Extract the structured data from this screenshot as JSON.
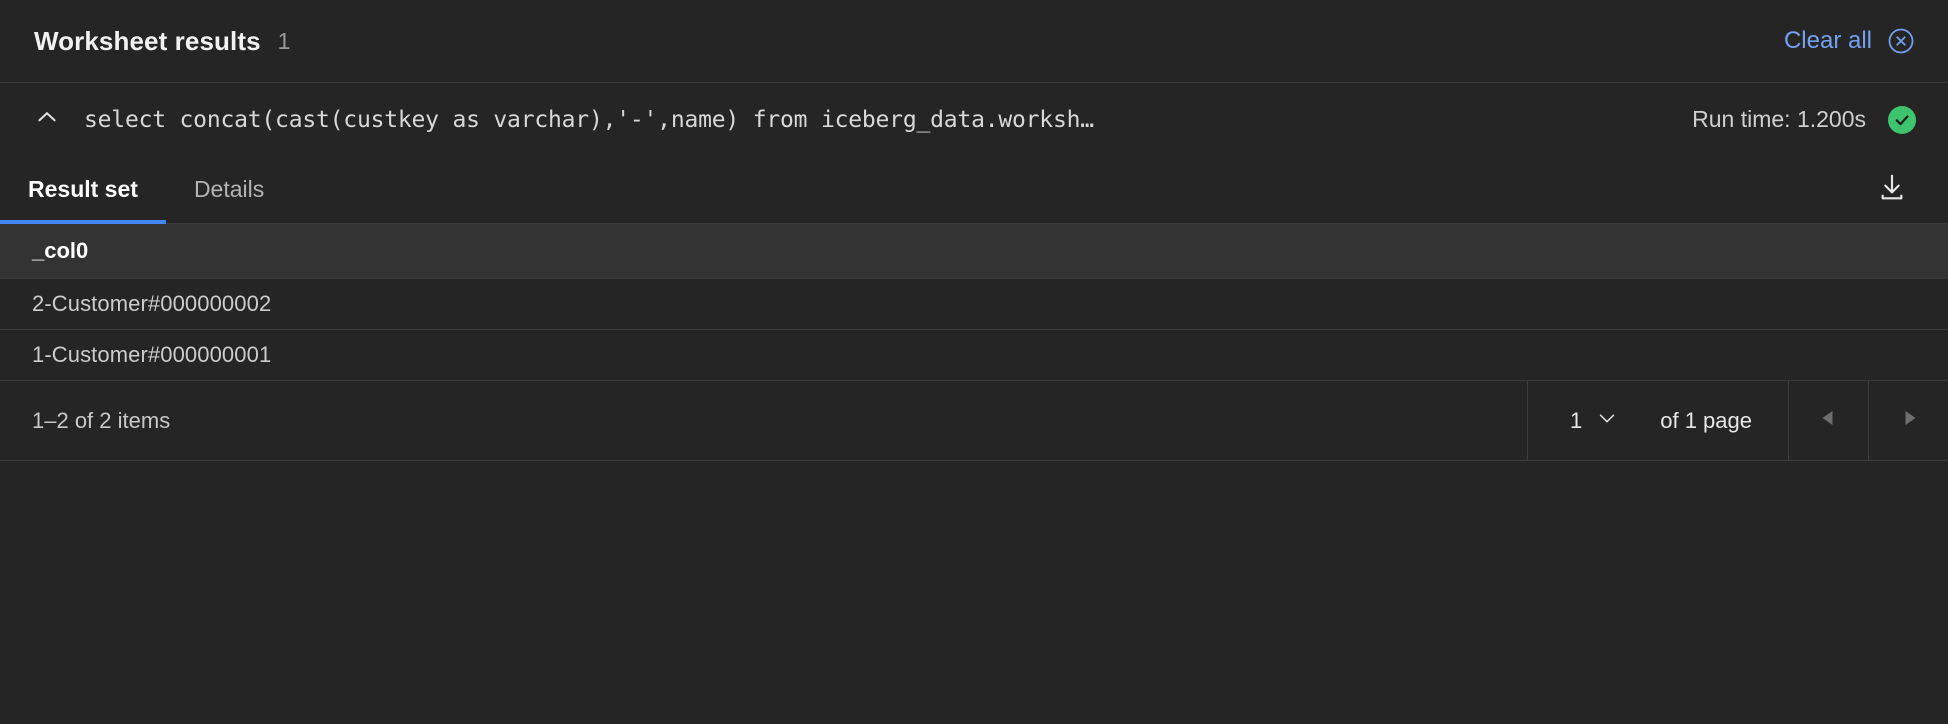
{
  "header": {
    "title": "Worksheet results",
    "count": "1",
    "clear_all_label": "Clear all",
    "close_icon": "close-circle-icon"
  },
  "query": {
    "collapse_icon": "chevron-up-icon",
    "sql": "select concat(cast(custkey as varchar),'-',name) from iceberg_data.worksh…",
    "runtime_label": "Run time: 1.200s",
    "status_icon": "check-circle-icon"
  },
  "tabs": [
    {
      "label": "Result set",
      "active": true
    },
    {
      "label": "Details",
      "active": false
    }
  ],
  "toolbar": {
    "download_icon": "download-icon"
  },
  "table": {
    "columns": [
      "_col0"
    ],
    "rows": [
      [
        "2-Customer#000000002"
      ],
      [
        "1-Customer#000000001"
      ]
    ]
  },
  "pagination": {
    "summary": "1–2 of 2 items",
    "page_value": "1",
    "page_chevron_icon": "chevron-down-icon",
    "page_of_label": "of 1 page",
    "prev_icon": "triangle-left-icon",
    "next_icon": "triangle-right-icon"
  },
  "colors": {
    "accent": "#4287f5",
    "link": "#74a0f0",
    "success": "#3ec46d",
    "panel_bg": "#252525",
    "header_row_bg": "#333333",
    "divider": "#3a3a3a"
  }
}
